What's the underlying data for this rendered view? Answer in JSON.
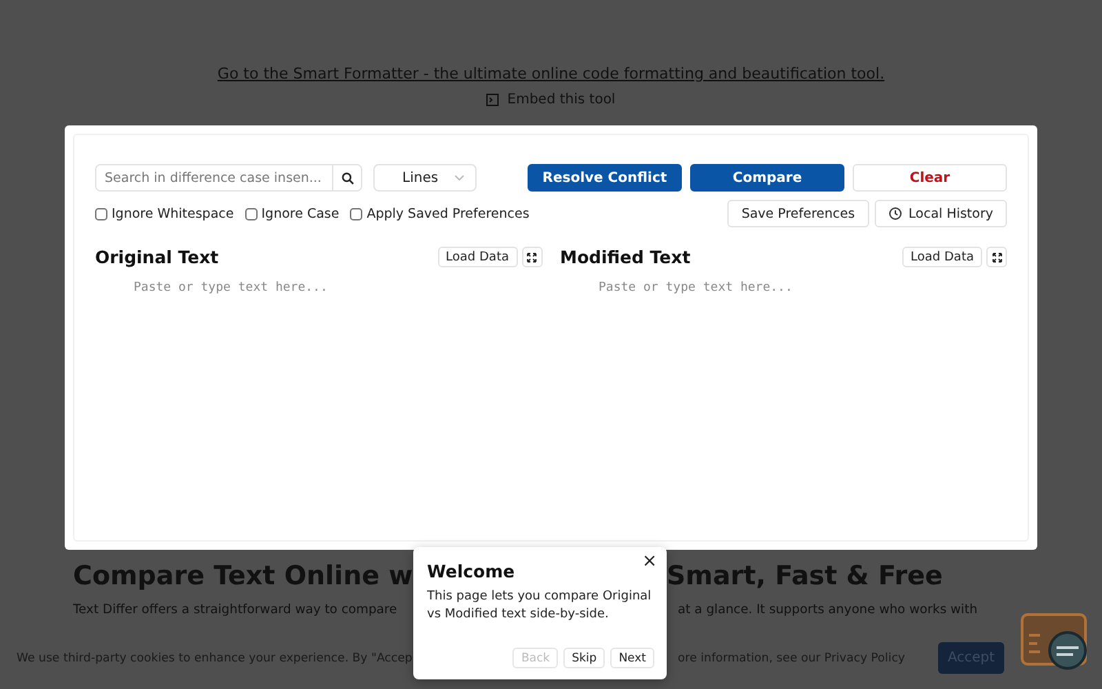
{
  "top_link": "Go to the Smart Formatter - the ultimate online code formatting and beautification tool.",
  "embed": "Embed this tool",
  "tool": {
    "search": {
      "placeholder": "Search in difference case insen..."
    },
    "mode": "Lines",
    "buttons": [
      {
        "label": "Resolve Conflict",
        "kind": "primary"
      },
      {
        "label": "Compare",
        "kind": "primary"
      },
      {
        "label": "Clear",
        "kind": "danger"
      }
    ],
    "options": [
      {
        "label": "Ignore Whitespace",
        "checked": false
      },
      {
        "label": "Ignore Case",
        "checked": false
      },
      {
        "label": "Apply Saved Preferences",
        "checked": false
      }
    ],
    "secondary_buttons": [
      {
        "label": "Save Preferences",
        "kind": "plain"
      },
      {
        "label": "Local History",
        "kind": "history"
      }
    ],
    "panes": [
      {
        "title": "Original Text",
        "load": "Load Data",
        "placeholder": "Paste or type text here..."
      },
      {
        "title": "Modified Text",
        "load": "Load Data",
        "placeholder": "Paste or type text here..."
      }
    ]
  },
  "article": {
    "heading_parts": [
      "Compare Text Online w",
      "Smart, Fast & Free"
    ],
    "paragraph_parts": [
      "Text Differ offers a straightforward way to compare",
      "at a glance. It supports anyone who works with"
    ]
  },
  "cookie_bar": {
    "text_parts": [
      "We use third-party cookies to enhance your experience. By \"Accep",
      "ore information, see our Privacy Policy"
    ],
    "accept": "Accept"
  },
  "tour": {
    "title": "Welcome",
    "body": "This page lets you compare Original vs Modified text side-by-side.",
    "close": "×",
    "buttons": [
      {
        "label": "Back",
        "disabled": true
      },
      {
        "label": "Skip",
        "disabled": false
      },
      {
        "label": "Next",
        "disabled": false
      }
    ]
  }
}
